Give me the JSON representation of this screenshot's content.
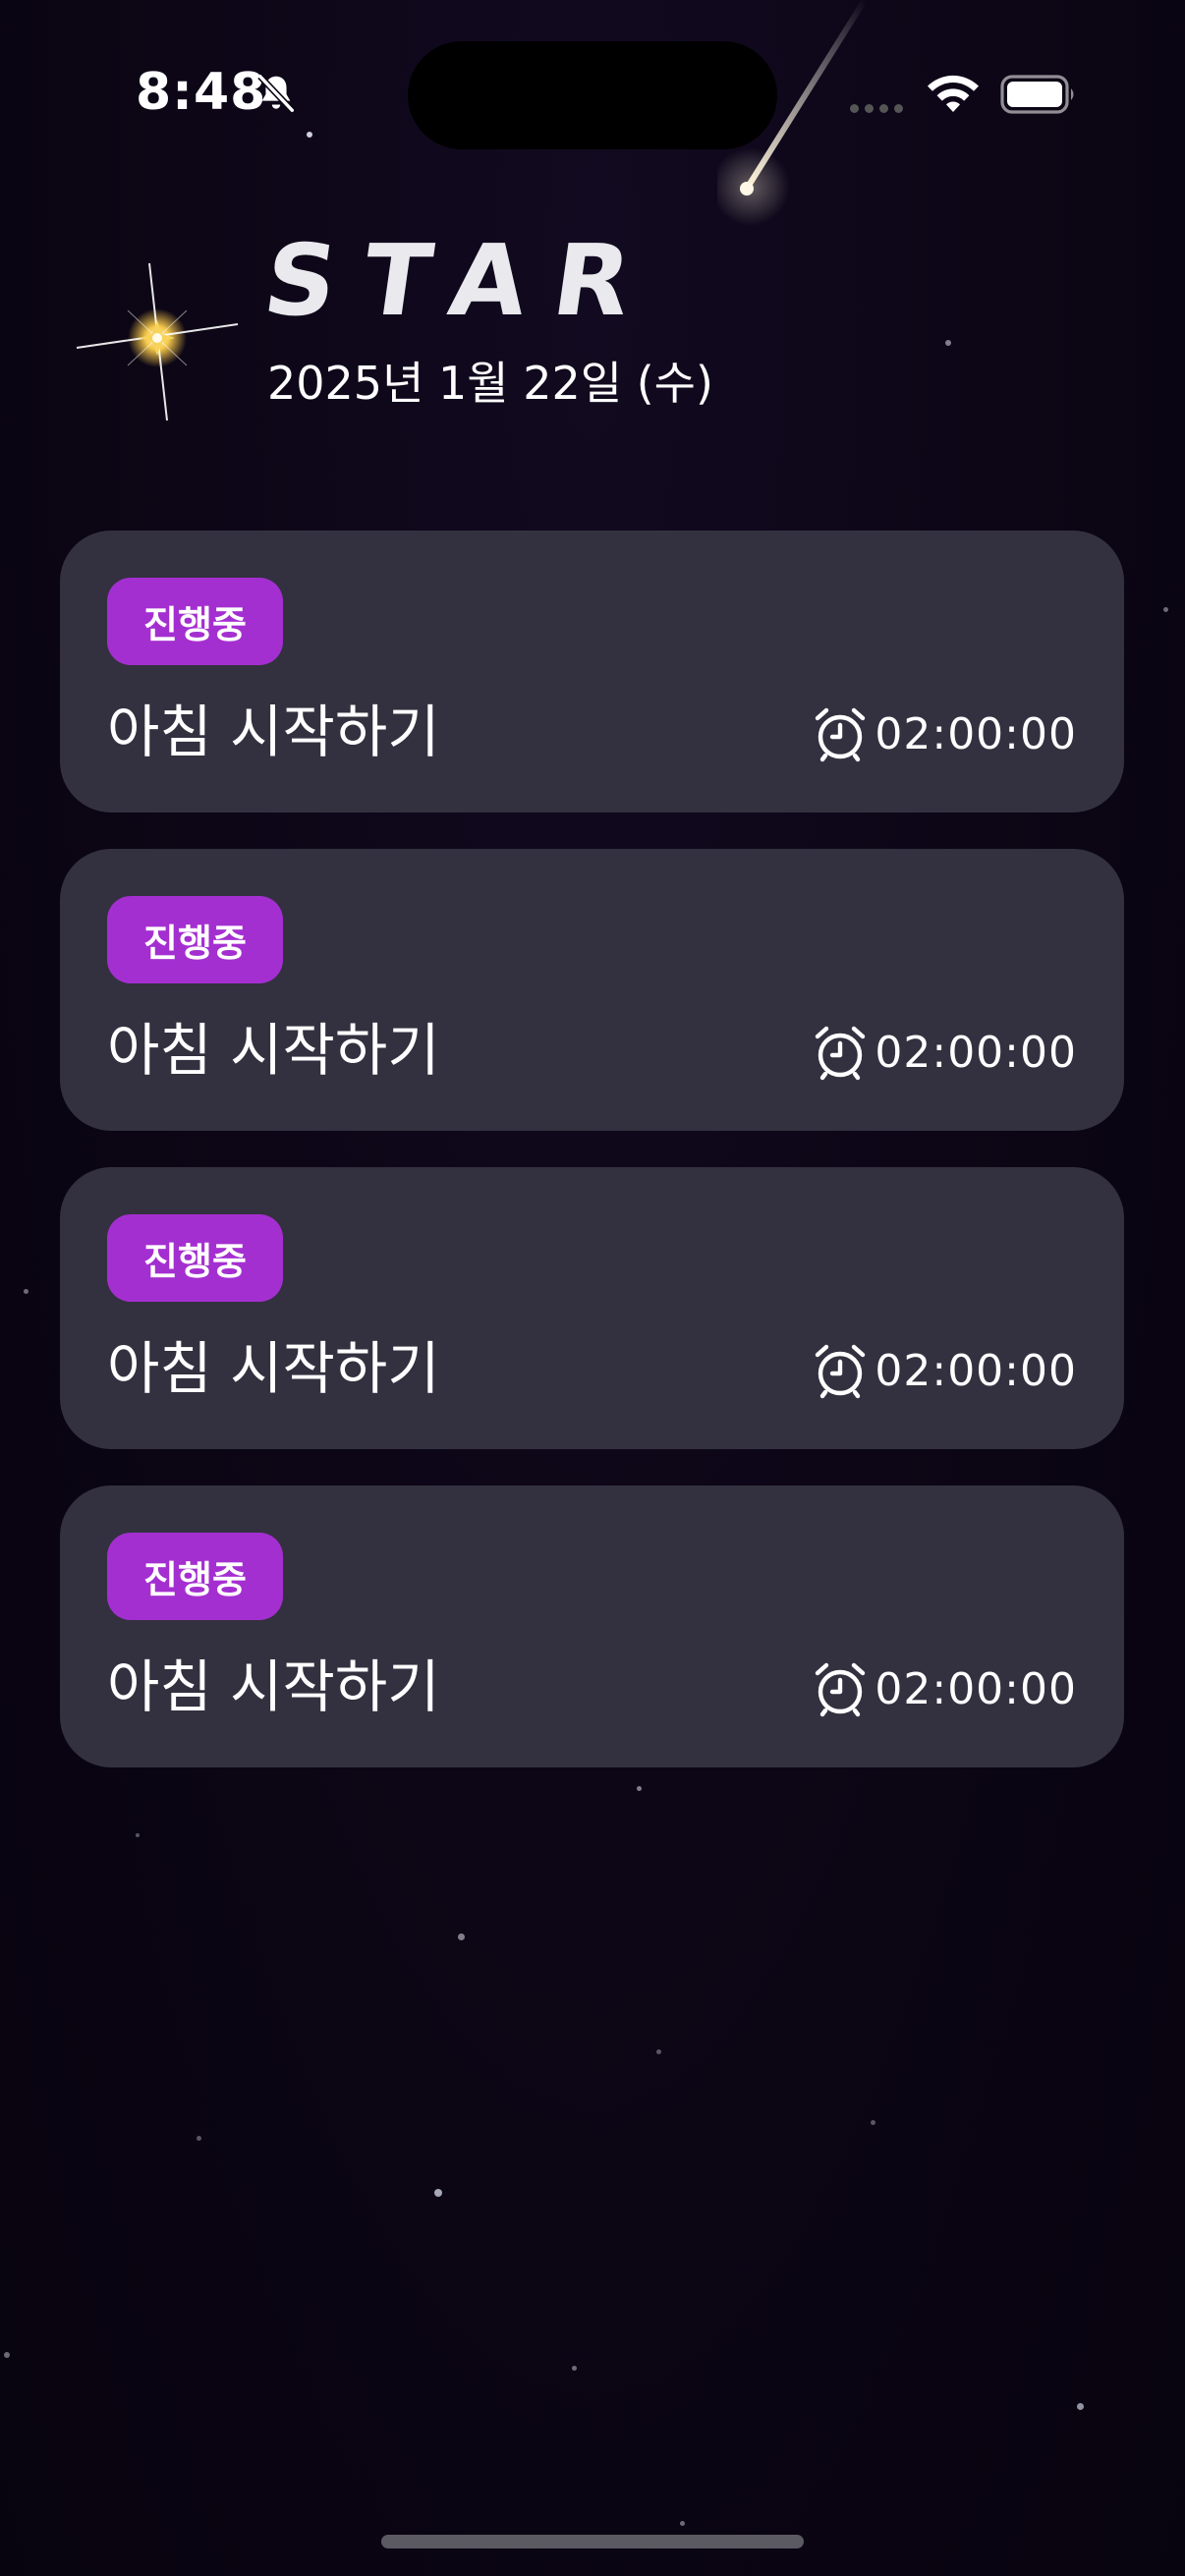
{
  "status_bar": {
    "time": "8:48"
  },
  "header": {
    "app_title": "STAR",
    "date": "2025년 1월 22일 (수)"
  },
  "tasks": [
    {
      "status": "진행중",
      "title": "아침 시작하기",
      "timer": "02:00:00"
    },
    {
      "status": "진행중",
      "title": "아침 시작하기",
      "timer": "02:00:00"
    },
    {
      "status": "진행중",
      "title": "아침 시작하기",
      "timer": "02:00:00"
    },
    {
      "status": "진행중",
      "title": "아침 시작하기",
      "timer": "02:00:00"
    }
  ],
  "colors": {
    "background": "#0b0514",
    "card": "#33313f",
    "badge": "#a42fd0",
    "text": "#ffffff"
  }
}
